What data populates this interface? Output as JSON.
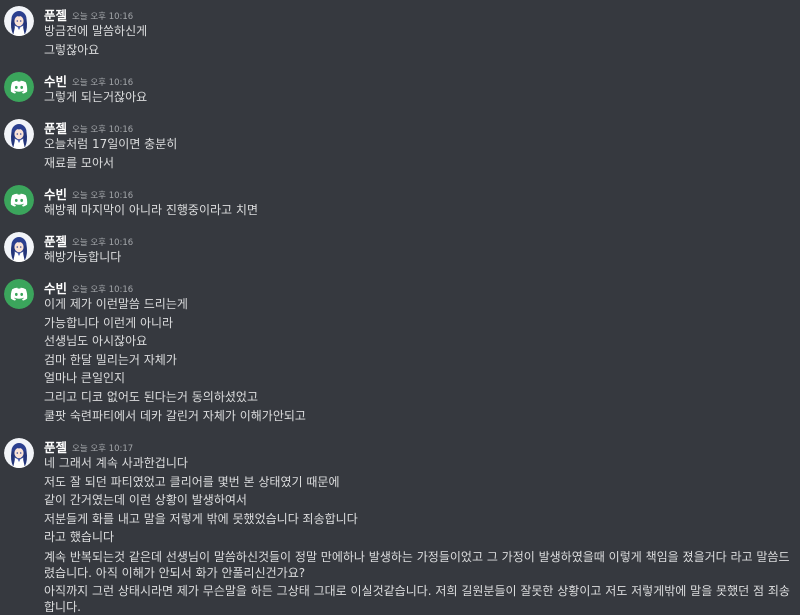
{
  "users": {
    "a": {
      "name": "푼젤"
    },
    "b": {
      "name": "수빈"
    }
  },
  "colors": {
    "background": "#36393f",
    "discord_avatar": "#3ba55c",
    "text": "#dcddde",
    "timestamp": "#a3a6aa"
  },
  "groups": [
    {
      "author": "푼젤",
      "avatar": "character-avatar",
      "time": "오늘 오후 10:16",
      "lines": [
        "방금전에 말씀하신게",
        "그렇잖아요"
      ]
    },
    {
      "author": "수빈",
      "avatar": "discord-logo-icon",
      "time": "오늘 오후 10:16",
      "lines": [
        "그렇게 되는거잖아요"
      ]
    },
    {
      "author": "푼젤",
      "avatar": "character-avatar",
      "time": "오늘 오후 10:16",
      "lines": [
        "오늘처럼 17일이면 충분히",
        "재료를 모아서"
      ]
    },
    {
      "author": "수빈",
      "avatar": "discord-logo-icon",
      "time": "오늘 오후 10:16",
      "lines": [
        "해방퀘 마지막이 아니라 진행중이라고 치면"
      ]
    },
    {
      "author": "푼젤",
      "avatar": "character-avatar",
      "time": "오늘 오후 10:16",
      "lines": [
        "해방가능합니다"
      ]
    },
    {
      "author": "수빈",
      "avatar": "discord-logo-icon",
      "time": "오늘 오후 10:16",
      "lines": [
        "이게 제가 이런말씀 드리는게",
        "가능합니다 이런게 아니라",
        "선생님도 아시잖아요",
        "검마 한달 밀리는거 자체가",
        "얼마나 큰일인지",
        "그리고 디코 없어도 된다는거 동의하셨었고",
        "쿨팟 숙련파티에서 데카 갈린거 자체가 이해가안되고"
      ]
    },
    {
      "author": "푼젤",
      "avatar": "character-avatar",
      "time": "오늘 오후 10:17",
      "lines": [
        "네 그래서 계속 사과한겁니다",
        "저도 잘 되던 파티였었고 클리어를 몇번 본 상태였기 때문에",
        "같이 간거였는데 이런 상황이 발생하여서",
        "저분들게 화를 내고 말을 저렇게 밖에 못했었습니다 죄송합니다",
        "라고 했습니다",
        "계속 반복되는것 같은데 선생님이 말씀하신것들이 정말 만에하나 발생하는 가정들이었고 그 가정이 발생하였을때 이렇게 책임을 졌을거다 라고 말씀드렸습니다. 아직 이해가 안되서 화가 안풀리신건가요?",
        "아직까지 그런 상태시라면 제가 무슨말을 하든 그상태 그대로 이실것같습니다. 저희 길원분들이 잘못한 상황이고 저도 저렇게밖에 말을 못했던 점 죄송합니다."
      ]
    }
  ]
}
